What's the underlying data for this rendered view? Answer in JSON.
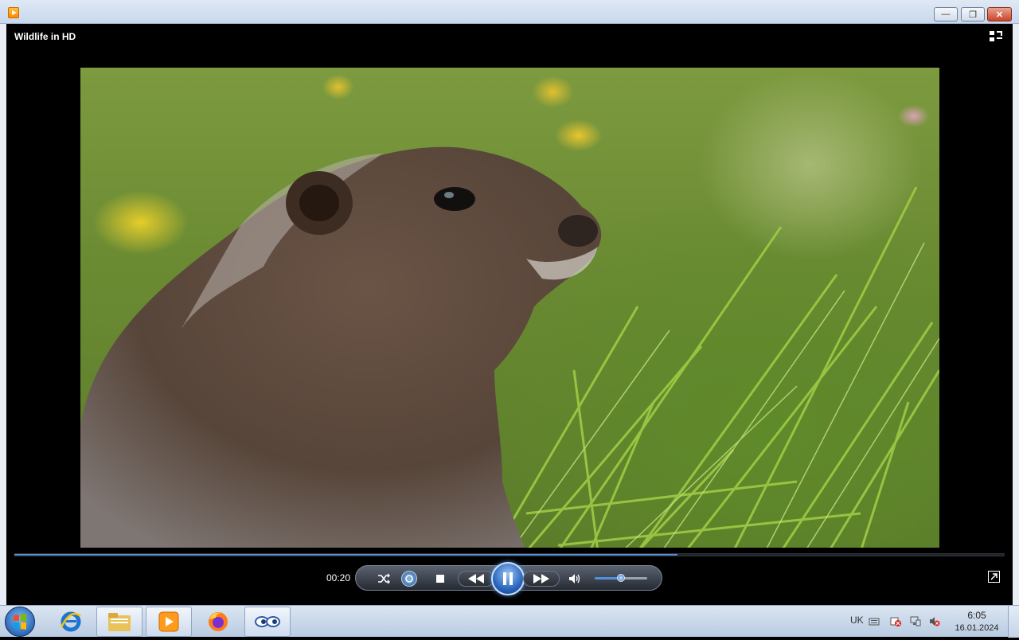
{
  "window": {
    "title": "Wildlife in HD",
    "minimize_glyph": "—",
    "maximize_glyph": "❐",
    "close_glyph": "✕"
  },
  "player": {
    "elapsed": "00:20",
    "progress_fraction": 0.67,
    "volume_fraction": 0.5,
    "controls": [
      "shuffle",
      "repeat",
      "stop",
      "previous",
      "pause",
      "next",
      "mute"
    ]
  },
  "taskbar": {
    "pinned": [
      "internet-explorer",
      "windows-explorer",
      "windows-media-player",
      "firefox",
      "app-eyes"
    ],
    "language": "UK",
    "time": "6:05",
    "date": "16.01.2024"
  },
  "colors": {
    "accent": "#2d64b5",
    "close": "#c9432a"
  }
}
